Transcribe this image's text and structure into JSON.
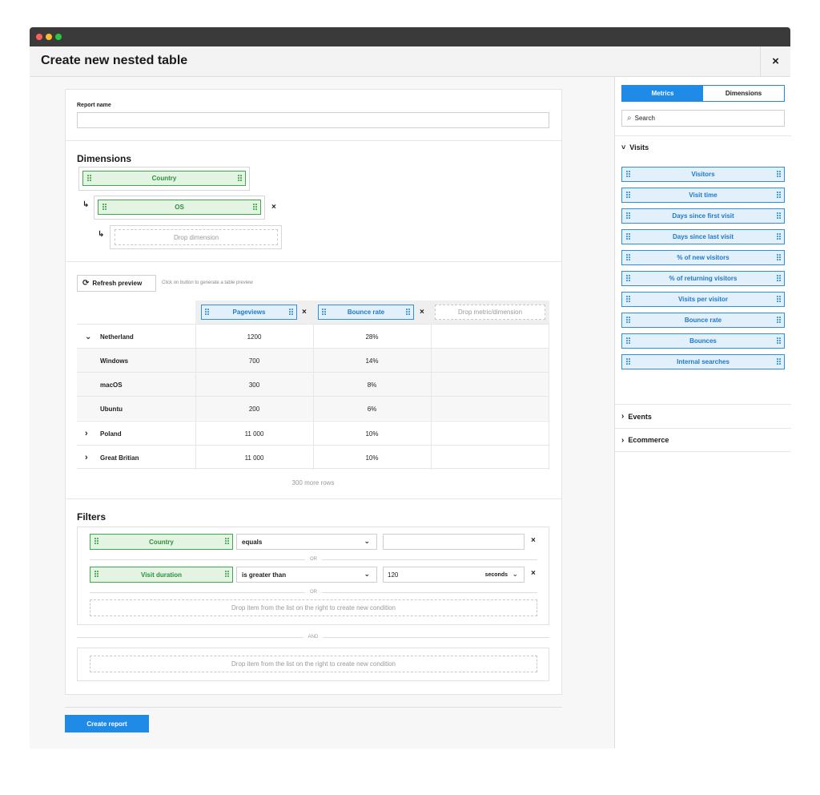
{
  "window": {
    "title": "Create new nested table",
    "close_label": "×",
    "traffic_lights": [
      "#ff5f57",
      "#febc2e",
      "#28c840"
    ]
  },
  "colors": {
    "accent_blue": "#1f8be6",
    "green": "#3fa64a",
    "green_fill": "#e3f4e3",
    "blue_fill": "#e2f0fb"
  },
  "report": {
    "name_label": "Report name",
    "name_value": ""
  },
  "dimensions": {
    "heading": "Dimensions",
    "level1": "Country",
    "level2": "OS",
    "remove_label": "×",
    "drop_placeholder": "Drop dimension"
  },
  "preview": {
    "refresh_label": "Refresh preview",
    "refresh_hint": "Click on button to generate a table preview",
    "columns": [
      "Pageviews",
      "Bounce rate"
    ],
    "drop_column": "Drop metric/dimension",
    "remove_label": "×",
    "rows": [
      {
        "label": "Netherland",
        "expander": "⌄",
        "pageviews": "1200",
        "bounce": "28%"
      },
      {
        "label": "Windows",
        "expander": "",
        "pageviews": "700",
        "bounce": "14%"
      },
      {
        "label": "macOS",
        "expander": "",
        "pageviews": "300",
        "bounce": "8%"
      },
      {
        "label": "Ubuntu",
        "expander": "",
        "pageviews": "200",
        "bounce": "6%"
      },
      {
        "label": "Poland",
        "expander": "›",
        "pageviews": "11 000",
        "bounce": "10%"
      },
      {
        "label": "Great Britian",
        "expander": "›",
        "pageviews": "11 000",
        "bounce": "10%"
      }
    ],
    "more_rows": "300 more rows"
  },
  "filters": {
    "heading": "Filters",
    "conditions": [
      {
        "field": "Country",
        "operator": "equals",
        "value": "",
        "unit": ""
      },
      {
        "field": "Visit duration",
        "operator": "is greater than",
        "value": "120",
        "unit": "seconds"
      }
    ],
    "or_label": "OR",
    "and_label": "AND",
    "drop_hint": "Drop item from the list on the right to create new condition",
    "remove_label": "×",
    "chevron": "⌄"
  },
  "actions": {
    "create_label": "Create report"
  },
  "sidebar": {
    "tabs": [
      {
        "label": "Metrics",
        "active": true
      },
      {
        "label": "Dimensions",
        "active": false
      }
    ],
    "search_placeholder": "Search",
    "groups": [
      {
        "label": "Visits",
        "expanded": true,
        "arrow": "˅",
        "items": [
          "Visitors",
          "Visit time",
          "Days since first visit",
          "Days since last visit",
          "% of new visitors",
          "% of returning visitors",
          "Visits per visitor",
          "Bounce rate",
          "Bounces",
          "Internal searches"
        ]
      },
      {
        "label": "Events",
        "expanded": false,
        "arrow": "›",
        "items": []
      },
      {
        "label": "Ecommerce",
        "expanded": false,
        "arrow": "›",
        "items": []
      }
    ]
  }
}
